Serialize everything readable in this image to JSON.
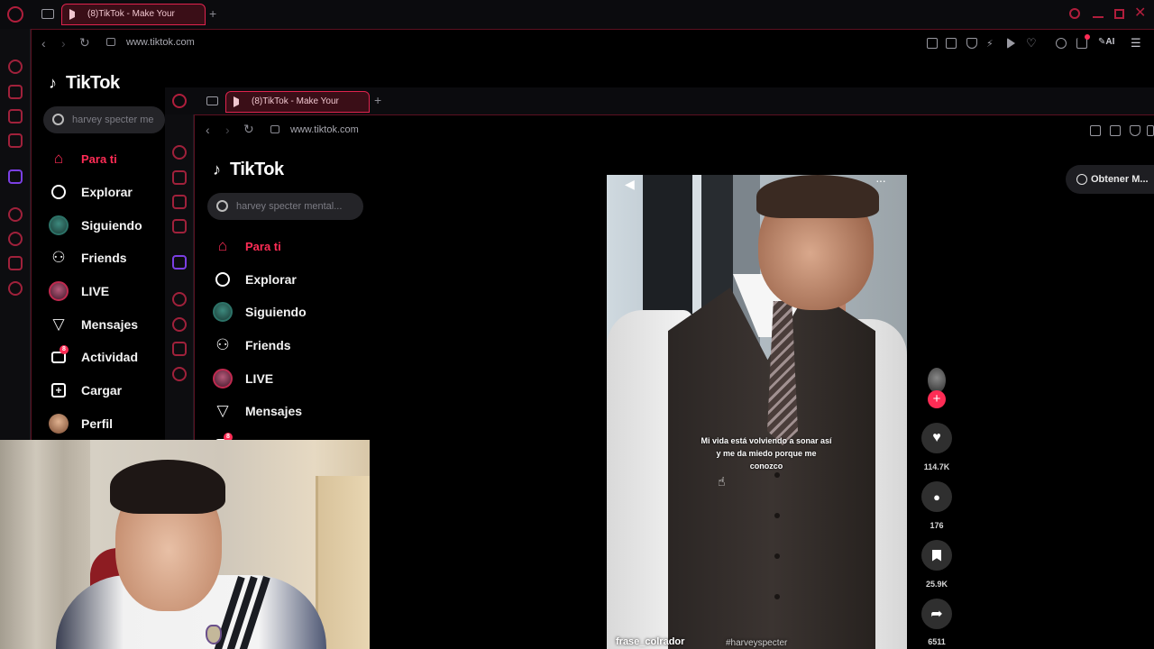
{
  "outer_browser": {
    "tab_title": "(8)TikTok - Make Your",
    "url": "www.tiktok.com",
    "ai_label": "AI"
  },
  "inner_browser": {
    "tab_title": "(8)TikTok - Make Your",
    "url": "www.tiktok.com",
    "get_button": "Obtener M..."
  },
  "tiktok": {
    "logo": "TikTok",
    "search_placeholder_outer": "harvey specter me",
    "search_placeholder_inner": "harvey specter mental...",
    "nav": [
      {
        "label": "Para ti",
        "icon": "home-icon"
      },
      {
        "label": "Explorar",
        "icon": "compass-icon"
      },
      {
        "label": "Siguiendo",
        "icon": "avatar"
      },
      {
        "label": "Friends",
        "icon": "friends-icon"
      },
      {
        "label": "LIVE",
        "icon": "live-avatar"
      },
      {
        "label": "Mensajes",
        "icon": "send-icon"
      },
      {
        "label": "Actividad",
        "icon": "activity-icon",
        "badge": "8"
      },
      {
        "label": "Cargar",
        "icon": "upload-icon"
      },
      {
        "label": "Perfil",
        "icon": "profile-avatar"
      }
    ],
    "video": {
      "caption": "Mi vida está volviendo a sonar así y me da miedo porque me conozco",
      "author": "frase_colrador",
      "hashtag": "#harveyspecter"
    },
    "actions": {
      "likes": "114.7K",
      "comments": "176",
      "saves": "25.9K",
      "shares": "6511"
    }
  },
  "colors": {
    "accent": "#fe2c55",
    "browser_accent": "#e0234e",
    "background": "#000000"
  }
}
